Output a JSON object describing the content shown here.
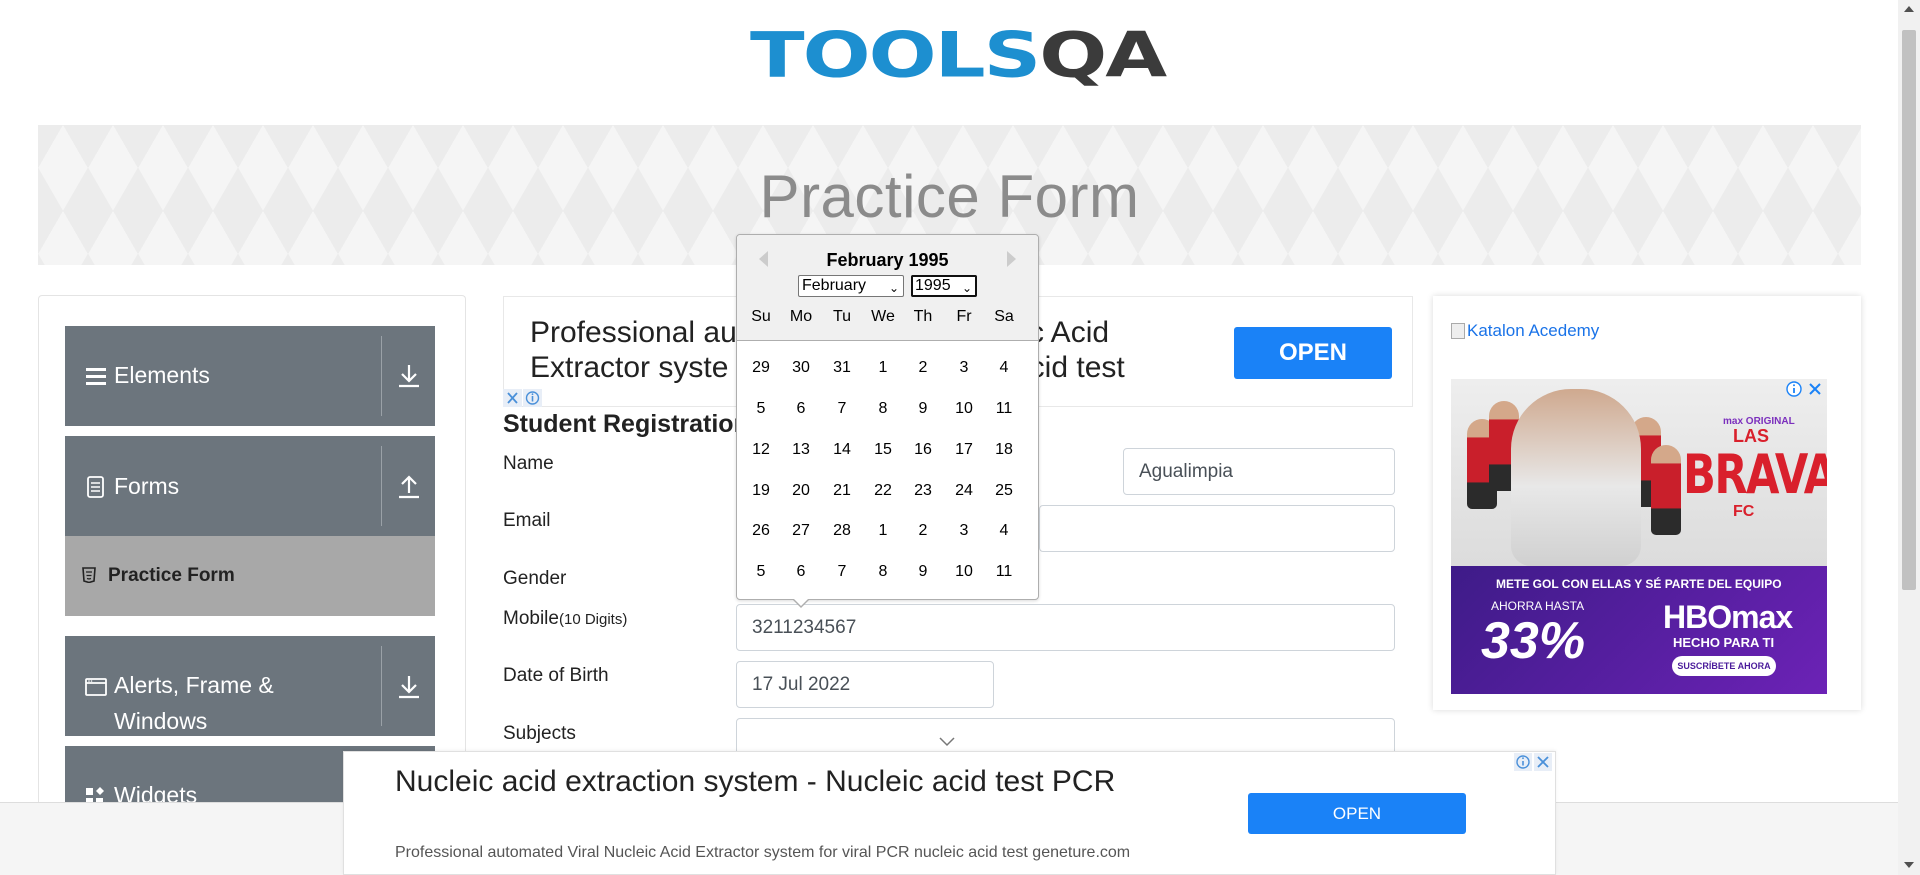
{
  "logo": {
    "part1": "TOOLS",
    "part2": "QA"
  },
  "banner": {
    "title": "Practice Form"
  },
  "sidebar": {
    "groups": [
      {
        "label": "Elements",
        "icon": "hamburger-icon",
        "arrow": "download-arrow-icon"
      },
      {
        "label": "Forms",
        "icon": "document-icon",
        "arrow": "upload-arrow-icon"
      },
      {
        "label": "Alerts, Frame &",
        "label2": "Windows",
        "icon": "window-icon",
        "arrow": "download-arrow-icon"
      },
      {
        "label": "Widgets",
        "icon": "widgets-icon"
      }
    ],
    "active_item": {
      "label": "Practice Form",
      "icon": "html5-icon"
    }
  },
  "ad_top": {
    "line1_left": "Professional au",
    "line1_right": "c Acid",
    "line2_left": "Extractor syste",
    "line2_right": "ic acid test",
    "button": "OPEN"
  },
  "form": {
    "title": "Student Registration",
    "name_label": "Name",
    "last_name_value": "Agualimpia",
    "email_label": "Email",
    "gender_label": "Gender",
    "mobile_label": "Mobile",
    "mobile_hint": "(10 Digits)",
    "mobile_value": "3211234567",
    "dob_label": "Date of Birth",
    "dob_value": "17 Jul 2022",
    "subjects_label": "Subjects"
  },
  "datepicker": {
    "header": "February 1995",
    "month_select": "February",
    "year_select": "1995",
    "day_names": [
      "Su",
      "Mo",
      "Tu",
      "We",
      "Th",
      "Fr",
      "Sa"
    ],
    "weeks": [
      [
        "29",
        "30",
        "31",
        "1",
        "2",
        "3",
        "4"
      ],
      [
        "5",
        "6",
        "7",
        "8",
        "9",
        "10",
        "11"
      ],
      [
        "12",
        "13",
        "14",
        "15",
        "16",
        "17",
        "18"
      ],
      [
        "19",
        "20",
        "21",
        "22",
        "23",
        "24",
        "25"
      ],
      [
        "26",
        "27",
        "28",
        "1",
        "2",
        "3",
        "4"
      ],
      [
        "5",
        "6",
        "7",
        "8",
        "9",
        "10",
        "11"
      ]
    ]
  },
  "right_ad": {
    "link": "Katalon Acedemy",
    "hbo": {
      "max_original": "max ORIGINAL",
      "las": "LAS",
      "bravas": "BRAVAS",
      "fc": "FC",
      "tagline": "METE GOL CON ELLAS Y SÉ PARTE DEL EQUIPO",
      "ahora": "AHORRA HASTA",
      "percent": "33%",
      "brand": "HBOmax",
      "hecho": "HECHO PARA TI",
      "cta": "SUSCRÍBETE AHORA"
    }
  },
  "bottom_ad": {
    "title": "Nucleic acid extraction system - Nucleic acid test PCR",
    "subtitle": "Professional automated Viral Nucleic Acid Extractor system for viral PCR nucleic acid test geneture.com",
    "button": "OPEN"
  },
  "colors": {
    "logo_blue": "#1d8fd0",
    "logo_dark": "#3b3b3b",
    "sidebar_gray": "#6c757d",
    "active_gray": "#a8a8a8",
    "ad_blue": "#1a82f7"
  }
}
